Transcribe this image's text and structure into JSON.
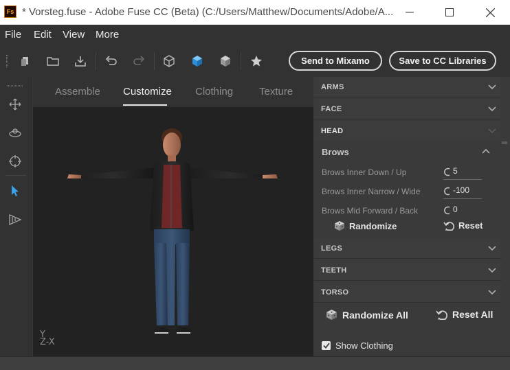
{
  "window": {
    "app_logo": "Fs",
    "title": "* Vorsteg.fuse - Adobe Fuse CC (Beta) (C:/Users/Matthew/Documents/Adobe/A..."
  },
  "menu": [
    "File",
    "Edit",
    "View",
    "More"
  ],
  "toolbar": {
    "icons": [
      "new-file-icon",
      "open-folder-icon",
      "import-icon",
      "undo-icon",
      "redo-icon",
      "wireframe-cube-icon",
      "shaded-cube-icon",
      "solid-cube-icon",
      "star-icon"
    ],
    "send_button": "Send to Mixamo",
    "save_button": "Save to CC Libraries"
  },
  "left_tools": [
    "move-icon",
    "orbit-icon",
    "target-icon",
    "pointer-icon",
    "dimension-icon"
  ],
  "tabs": [
    {
      "label": "Assemble",
      "active": false
    },
    {
      "label": "Customize",
      "active": true
    },
    {
      "label": "Clothing",
      "active": false
    },
    {
      "label": "Texture",
      "active": false
    }
  ],
  "viewport": {
    "axis_y": "Y",
    "axis_zx": "Z-X"
  },
  "panel": {
    "sections_top": [
      "ARMS",
      "FACE",
      "HEAD"
    ],
    "subsection": "Brows",
    "params": [
      {
        "label": "Brows Inner Down / Up",
        "value": "5"
      },
      {
        "label": "Brows Inner Narrow / Wide",
        "value": "-100"
      },
      {
        "label": "Brows Mid Forward / Back",
        "value": "0"
      }
    ],
    "randomize": "Randomize",
    "reset": "Reset",
    "sections_bottom": [
      "LEGS",
      "TEETH",
      "TORSO"
    ],
    "randomize_all": "Randomize All",
    "reset_all": "Reset All",
    "show_clothing": "Show Clothing",
    "show_clothing_checked": true
  },
  "colors": {
    "accent_blue": "#3ca2e8",
    "background": "#3a3a3a",
    "viewport": "#222222"
  }
}
